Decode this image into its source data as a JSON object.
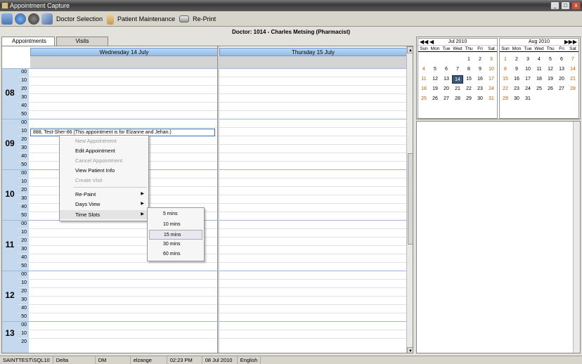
{
  "window": {
    "title": "Appointment Capture",
    "min": "_",
    "max": "□",
    "close": "x"
  },
  "toolbar": {
    "doctor_selection": "Doctor Selection",
    "patient_maintenance": "Patient Maintenance",
    "reprint": "Re-Print"
  },
  "doctor_header": "Doctor: 1014 - Charles Metsing (Pharmacist)",
  "tabs": [
    "Appointments",
    "Visits"
  ],
  "days": [
    "Wednesday 14 July",
    "Thursday 15 July"
  ],
  "hours": [
    {
      "h": "08",
      "mins": [
        "00",
        "10",
        "20",
        "30",
        "40",
        "50"
      ]
    },
    {
      "h": "09",
      "mins": [
        "00",
        "10",
        "20",
        "30",
        "40",
        "50"
      ]
    },
    {
      "h": "10",
      "mins": [
        "00",
        "10",
        "20",
        "30",
        "40",
        "50"
      ]
    },
    {
      "h": "11",
      "mins": [
        "00",
        "10",
        "20",
        "30",
        "40",
        "50"
      ]
    },
    {
      "h": "12",
      "mins": [
        "00",
        "10",
        "20",
        "30",
        "40",
        "50"
      ]
    },
    {
      "h": "13",
      "mins": [
        "00",
        "10",
        "20"
      ]
    }
  ],
  "appointment": "888, Test-Sher-86 (This appointment is for Elzanne and Jehan.)",
  "context_menu": {
    "items": [
      "New Appointment",
      "Edit Appointment",
      "Cancel Appointment",
      "View Patient Info",
      "Create Visit",
      "Re-Paint",
      "Days View",
      "Time Slots"
    ],
    "disabled": [
      true,
      false,
      true,
      false,
      true,
      false,
      false,
      false
    ]
  },
  "time_slots": [
    "5 mins",
    "10 mins",
    "15 mins",
    "30 mins",
    "60 mins"
  ],
  "minical": [
    {
      "month": "Jul 2010",
      "dow": [
        "Sun",
        "Mon",
        "Tue",
        "Wed",
        "Thu",
        "Fri",
        "Sat"
      ],
      "days": [
        "",
        "",
        "",
        "",
        "1",
        "2",
        "3",
        "4",
        "5",
        "6",
        "7",
        "8",
        "9",
        "10",
        "11",
        "12",
        "13",
        "14",
        "15",
        "16",
        "17",
        "18",
        "19",
        "20",
        "21",
        "22",
        "23",
        "24",
        "25",
        "26",
        "27",
        "28",
        "29",
        "30",
        "31"
      ],
      "selected": "14"
    },
    {
      "month": "Aug 2010",
      "dow": [
        "Sun",
        "Mon",
        "Tue",
        "Wed",
        "Thu",
        "Fri",
        "Sat"
      ],
      "days": [
        "1",
        "2",
        "3",
        "4",
        "5",
        "6",
        "7",
        "8",
        "9",
        "10",
        "11",
        "12",
        "13",
        "14",
        "15",
        "16",
        "17",
        "18",
        "19",
        "20",
        "21",
        "22",
        "23",
        "24",
        "25",
        "26",
        "27",
        "28",
        "29",
        "30",
        "31"
      ],
      "selected": ""
    }
  ],
  "status": [
    "SAINTTEST\\SQL10",
    "Delta",
    "DM",
    "elzange",
    "02:23 PM",
    "08 Jul 2010",
    "English"
  ]
}
